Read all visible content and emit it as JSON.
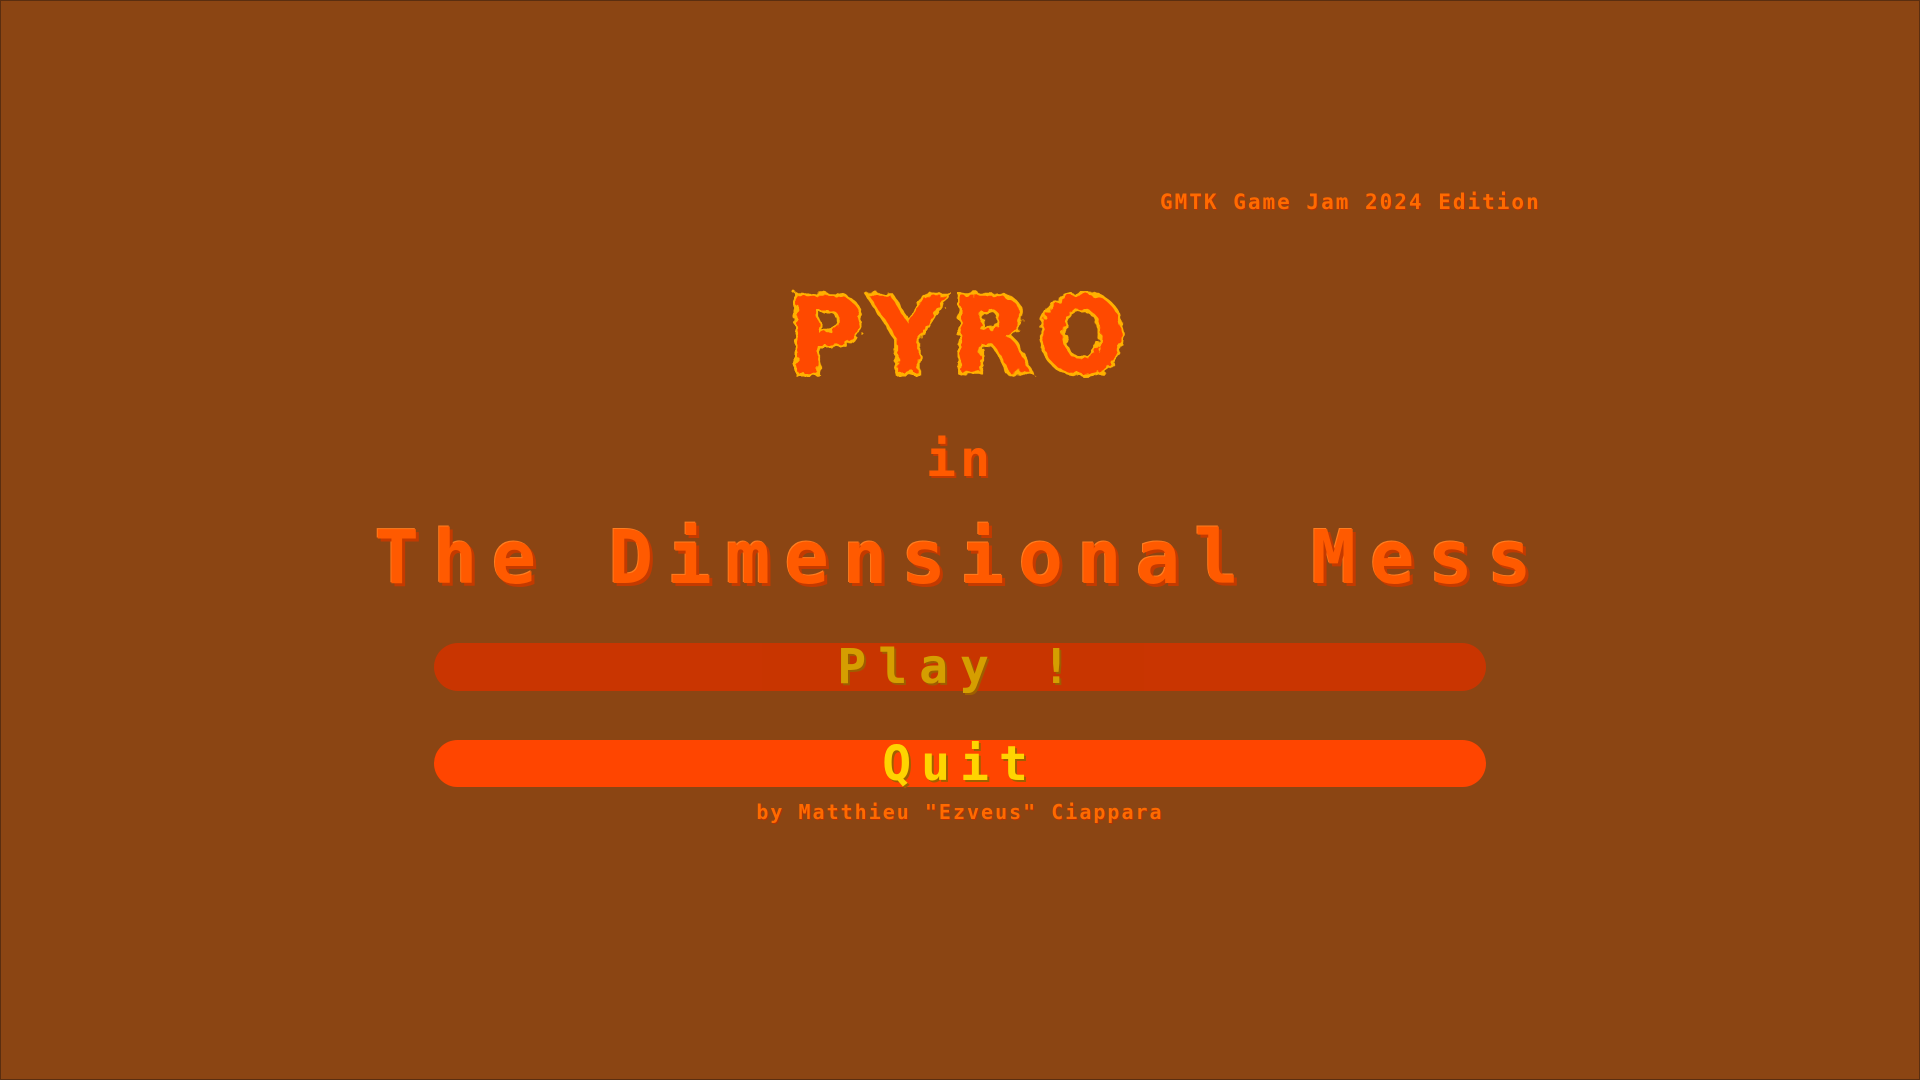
{
  "edition_label": "GMTK Game Jam 2024 Edition",
  "logo": {
    "text": "PYRO",
    "fill_color": "#ff4a00",
    "outline_color": "#ffb000"
  },
  "subtitle": "in",
  "title": "The Dimensional Mess",
  "menu": {
    "play_label": "Play !",
    "quit_label": "Quit"
  },
  "credits": "by Matthieu \"Ezveus\" Ciappara",
  "colors": {
    "background": "#8B4513",
    "play_button": "#cc3500",
    "quit_button": "#ff4500",
    "button_text": "#ffd400",
    "title_text": "#ff5a00"
  }
}
